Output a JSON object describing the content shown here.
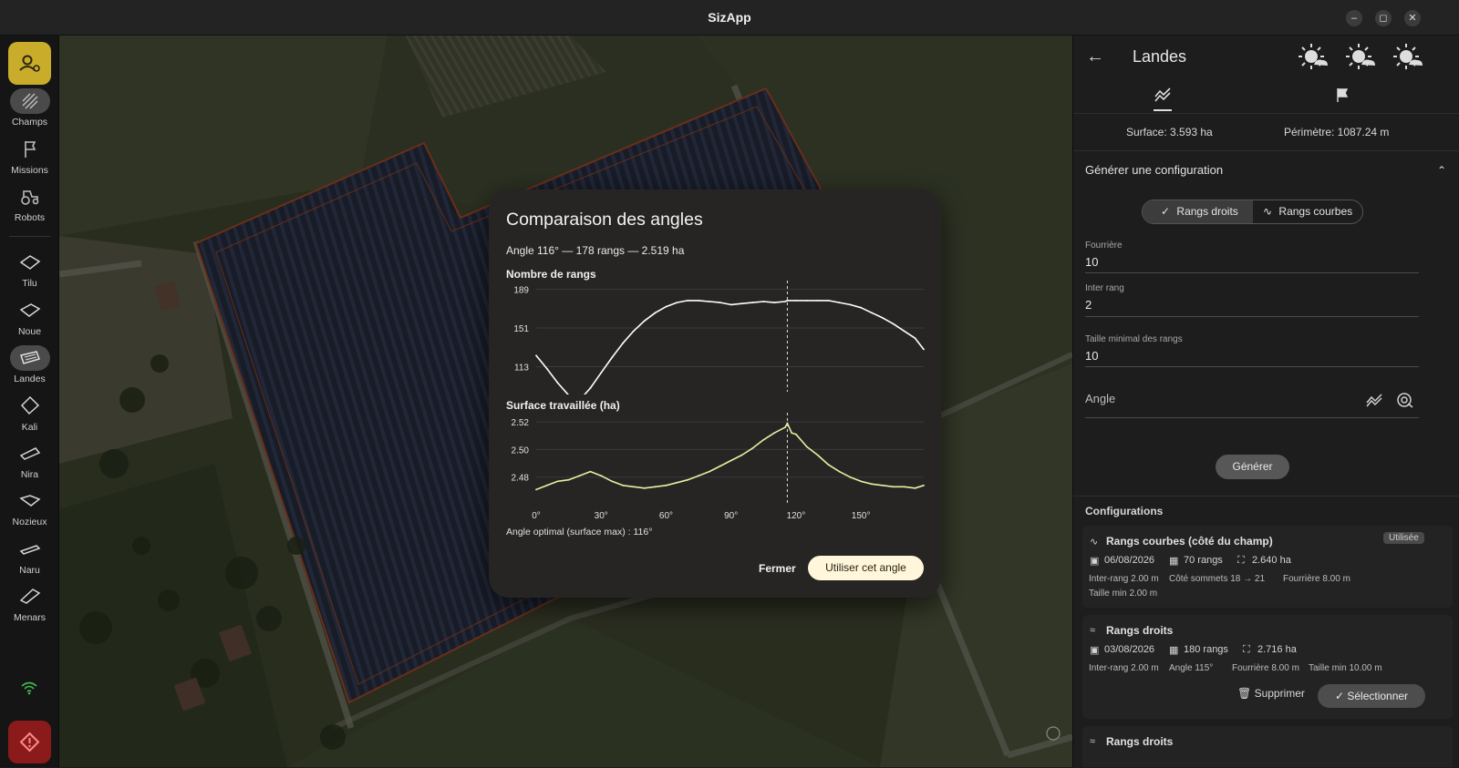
{
  "window": {
    "title": "SizApp",
    "controls": [
      "–",
      "◻",
      "✕"
    ]
  },
  "sidebar": {
    "items": [
      {
        "label": "Champs",
        "icon": "fields-icon"
      },
      {
        "label": "Missions",
        "icon": "flag-icon"
      },
      {
        "label": "Robots",
        "icon": "tractor-icon"
      },
      {
        "label": "Tilu",
        "icon": "parcel-icon"
      },
      {
        "label": "Noue",
        "icon": "parcel-icon"
      },
      {
        "label": "Landes",
        "icon": "parcel-icon"
      },
      {
        "label": "Kali",
        "icon": "parcel-icon"
      },
      {
        "label": "Nira",
        "icon": "parcel-icon"
      },
      {
        "label": "Nozieux",
        "icon": "parcel-icon"
      },
      {
        "label": "Naru",
        "icon": "parcel-icon"
      },
      {
        "label": "Menars",
        "icon": "parcel-icon"
      }
    ],
    "active": "Landes"
  },
  "modal": {
    "title": "Comparaison des angles",
    "info": "Angle 116° — 178 rangs — 2.519 ha",
    "section_rows": "Nombre de rangs",
    "section_surface": "Surface travaillée (ha)",
    "optimal_note": "Angle optimal (surface max) : 116°",
    "close_label": "Fermer",
    "use_label": "Utiliser cet angle"
  },
  "chart_data": [
    {
      "type": "line",
      "title": "Nombre de rangs",
      "x": [
        0,
        5,
        10,
        15,
        20,
        25,
        30,
        35,
        40,
        45,
        50,
        55,
        60,
        65,
        70,
        75,
        80,
        85,
        90,
        95,
        100,
        105,
        110,
        115,
        116,
        120,
        125,
        130,
        135,
        140,
        145,
        150,
        155,
        160,
        165,
        170,
        175,
        179
      ],
      "y": [
        124,
        111,
        97,
        85,
        80,
        92,
        107,
        122,
        136,
        148,
        158,
        166,
        172,
        176,
        178,
        178,
        177,
        176,
        174,
        175,
        176,
        177,
        176,
        177,
        178,
        178,
        178,
        178,
        178,
        176,
        174,
        171,
        166,
        161,
        155,
        148,
        141,
        130
      ],
      "ytick_labels": [
        "113",
        "151",
        "189"
      ],
      "ylim": [
        92,
        194
      ],
      "xlim": [
        0,
        179
      ],
      "marker_x": 116,
      "color": "#ffffff"
    },
    {
      "type": "line",
      "title": "Surface travaillée (ha)",
      "x": [
        0,
        5,
        10,
        15,
        20,
        25,
        30,
        35,
        40,
        45,
        50,
        55,
        60,
        65,
        70,
        75,
        80,
        85,
        90,
        95,
        100,
        105,
        110,
        115,
        116,
        118,
        120,
        125,
        130,
        135,
        140,
        145,
        150,
        155,
        160,
        165,
        170,
        175,
        179
      ],
      "y": [
        2.471,
        2.474,
        2.477,
        2.478,
        2.481,
        2.484,
        2.481,
        2.477,
        2.474,
        2.473,
        2.472,
        2.473,
        2.474,
        2.476,
        2.478,
        2.481,
        2.484,
        2.488,
        2.492,
        2.496,
        2.501,
        2.507,
        2.512,
        2.516,
        2.519,
        2.512,
        2.511,
        2.502,
        2.496,
        2.489,
        2.484,
        2.48,
        2.477,
        2.475,
        2.474,
        2.473,
        2.473,
        2.472,
        2.474
      ],
      "ytick_labels": [
        "2.48",
        "2.50",
        "2.52"
      ],
      "xtick_labels": [
        "0°",
        "30°",
        "60°",
        "90°",
        "120°",
        "150°"
      ],
      "ylim": [
        2.462,
        2.524
      ],
      "xlim": [
        0,
        179
      ],
      "marker_x": 116,
      "color": "#e6f0a0"
    }
  ],
  "panel": {
    "title": "Landes",
    "surface": "Surface: 3.593 ha",
    "perimeter": "Périmètre: 1087.24 m",
    "generate_header": "Générer une configuration",
    "seg_straight": "Rangs droits",
    "seg_curved": "Rangs courbes",
    "fields": [
      {
        "label": "Fourrière",
        "value": "10"
      },
      {
        "label": "Inter rang",
        "value": "2"
      },
      {
        "label": "Taille minimal des rangs",
        "value": "10"
      }
    ],
    "angle_label": "Angle",
    "generate_button": "Générer",
    "configs_header": "Configurations",
    "configs": [
      {
        "title": "Rangs courbes (côté du champ)",
        "badge": "Utilisée",
        "date": "06/08/2026",
        "rows": "70 rangs",
        "area": "2.640 ha",
        "line1": "Inter-rang 2.00 m",
        "line2": "Côté sommets 18 → 21",
        "line3": "Fourrière 8.00 m",
        "line4": "Taille min 2.00 m"
      },
      {
        "title": "Rangs droits",
        "date": "03/08/2026",
        "rows": "180 rangs",
        "area": "2.716 ha",
        "line1": "Inter-rang 2.00 m",
        "line2": "Angle 115°",
        "line3": "Fourrière 8.00 m",
        "line4": "Taille min 10.00 m",
        "delete_label": "Supprimer",
        "select_label": "Sélectionner"
      },
      {
        "title": "Rangs droits"
      }
    ]
  }
}
